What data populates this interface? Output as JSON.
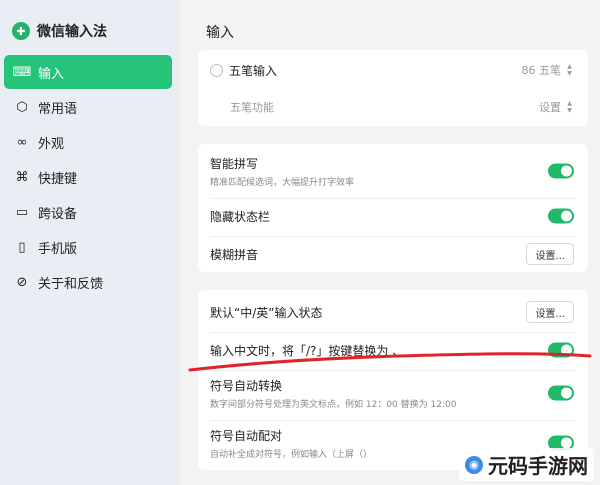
{
  "app": {
    "title": "微信输入法"
  },
  "sidebar": {
    "items": [
      {
        "label": "输入",
        "icon": "keyboard-icon",
        "active": true
      },
      {
        "label": "常用语",
        "icon": "cube-icon"
      },
      {
        "label": "外观",
        "icon": "rings-icon"
      },
      {
        "label": "快捷键",
        "icon": "command-icon"
      },
      {
        "label": "跨设备",
        "icon": "devices-icon"
      },
      {
        "label": "手机版",
        "icon": "phone-icon"
      },
      {
        "label": "关于和反馈",
        "icon": "compass-icon"
      }
    ]
  },
  "main": {
    "section_title": "输入",
    "wubi": {
      "label": "五笔输入",
      "select_value": "86 五笔",
      "func_label": "五笔功能",
      "func_select": "设置"
    },
    "card2": {
      "smart_pinyin": {
        "label": "智能拼写",
        "desc": "精准匹配候选词，大幅提升打字效率",
        "on": true
      },
      "hide_statusbar": {
        "label": "隐藏状态栏",
        "on": true
      },
      "fuzzy_pinyin": {
        "label": "模糊拼音",
        "button": "设置..."
      }
    },
    "card3": {
      "default_state": {
        "label": "默认“中/英”输入状态",
        "button": "设置..."
      },
      "replace_key": {
        "label": "输入中文时，将「/?」按键替换为 、",
        "on": true
      },
      "symbol_convert": {
        "label": "符号自动转换",
        "desc": "数字间部分符号处理为英文标点，例如 12：00 替换为 12:00",
        "on": true
      },
      "symbol_pair": {
        "label": "符号自动配对",
        "desc": "自动补全成对符号，例如输入（上屏（）",
        "on": true
      }
    }
  },
  "watermark": {
    "text": "元码手游网"
  },
  "colors": {
    "accent": "#25c47a",
    "toggle": "#21b868",
    "annotation": "#e0242a"
  }
}
